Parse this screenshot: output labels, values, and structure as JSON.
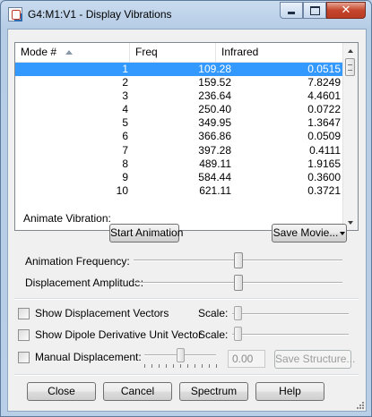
{
  "window": {
    "title": "G4:M1:V1 - Display Vibrations",
    "icons": {
      "app": "app-icon",
      "minimize": "minimize-icon",
      "maximize": "maximize-icon",
      "close": "close-icon"
    }
  },
  "table": {
    "columns": [
      "Mode #",
      "Freq",
      "Infrared"
    ],
    "sort_icon": "sort-ascending-icon",
    "rows": [
      {
        "mode": "1",
        "freq": "109.28",
        "ir": "0.0515",
        "selected": true
      },
      {
        "mode": "2",
        "freq": "159.52",
        "ir": "7.8249"
      },
      {
        "mode": "3",
        "freq": "236.64",
        "ir": "4.4601"
      },
      {
        "mode": "4",
        "freq": "250.40",
        "ir": "0.0722"
      },
      {
        "mode": "5",
        "freq": "349.95",
        "ir": "1.3647"
      },
      {
        "mode": "6",
        "freq": "366.86",
        "ir": "0.0509"
      },
      {
        "mode": "7",
        "freq": "397.28",
        "ir": "0.4111"
      },
      {
        "mode": "8",
        "freq": "489.11",
        "ir": "1.9165"
      },
      {
        "mode": "9",
        "freq": "584.44",
        "ir": "0.3600"
      },
      {
        "mode": "10",
        "freq": "621.11",
        "ir": "0.3721"
      }
    ]
  },
  "animate": {
    "section_label": "Animate Vibration:",
    "start_button": "Start Animation",
    "save_movie_button": "Save Movie...",
    "frequency_label": "Animation Frequency:",
    "frequency_level": 0.5,
    "amplitude_label": "Displacement Amplitude:",
    "amplitude_level": 0.5
  },
  "options": {
    "show_displacement_vectors": "Show Displacement Vectors",
    "show_dipole_vector": "Show Dipole Derivative Unit Vector",
    "scale_label": "Scale:",
    "scale_level": 0.05,
    "manual_displacement": "Manual Displacement:",
    "manual_level": 0.5,
    "manual_value": "0.00",
    "save_structure_button": "Save Structure..."
  },
  "footer": {
    "close": "Close",
    "cancel": "Cancel",
    "spectrum": "Spectrum",
    "help": "Help"
  }
}
